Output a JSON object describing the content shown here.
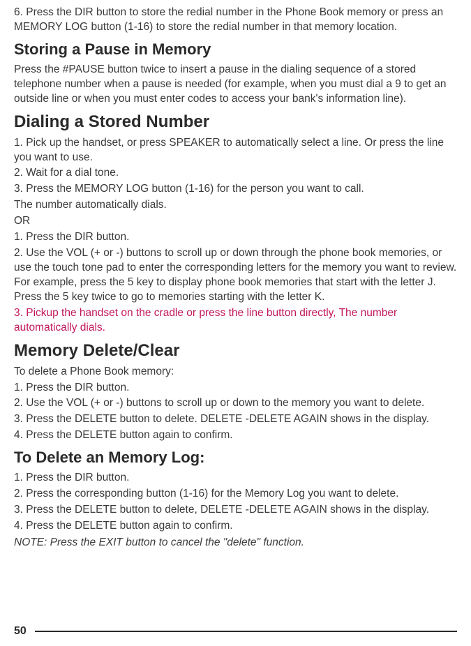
{
  "intro": {
    "p1": "6. Press the DIR button to store the redial number in the Phone Book memory or press an MEMORY LOG button (1-16) to store the redial number in that memory location."
  },
  "section1": {
    "heading": "Storing a Pause in Memory",
    "p1": "Press the #PAUSE button twice to insert a pause in the dialing sequence of a stored telephone number when a pause is needed (for example, when you must dial a 9 to get an outside line or when you must enter codes to access your bank's information line)."
  },
  "section2": {
    "heading": "Dialing a Stored Number",
    "p1": "1. Pick up the handset, or press SPEAKER to automatically select a line. Or press the line you want to use.",
    "p2": "2. Wait for a dial tone.",
    "p3": "3. Press the MEMORY LOG button (1-16) for the person you want to call.",
    "p4": "The number automatically dials.",
    "p5": "OR",
    "p6": "1. Press the DIR button.",
    "p7": "2. Use the VOL (+ or -) buttons to scroll up or down through the phone book memories, or use the touch tone pad to enter the corresponding letters for the memory you want to review. For example, press the 5 key to display phone book memories that start with the letter J. Press the 5 key twice to go to memories starting with the letter K.",
    "p8": "3. Pickup the handset on the cradle or press the line button directly, The number automatically dials."
  },
  "section3": {
    "heading": "Memory Delete/Clear",
    "p1": "To delete a Phone Book memory:",
    "p2": "1. Press the DIR button.",
    "p3": "2. Use the VOL (+ or -) buttons to scroll up or down to the memory you want to delete.",
    "p4": "3. Press the DELETE button to delete. DELETE -DELETE AGAIN shows in the display.",
    "p5": "4. Press the DELETE button again to confirm."
  },
  "section4": {
    "heading": "To Delete an Memory Log:",
    "p1": "1. Press the DIR button.",
    "p2": "2. Press the corresponding button (1-16) for the Memory Log you want to delete.",
    "p3": "3. Press the DELETE button to delete, DELETE -DELETE AGAIN shows in the display.",
    "p4": "4. Press the DELETE button again to confirm.",
    "note": "NOTE: Press the EXIT button to cancel the \"delete\" function."
  },
  "footer": {
    "page": "50"
  }
}
